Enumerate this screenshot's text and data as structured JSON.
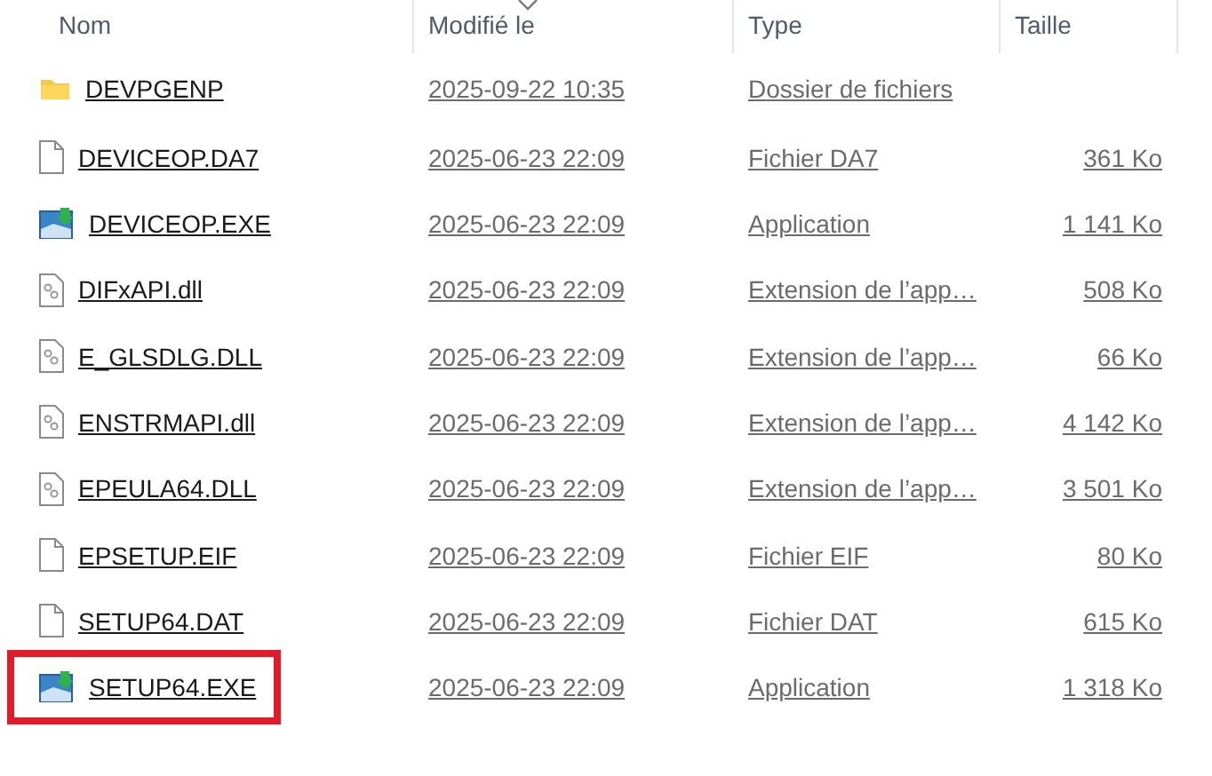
{
  "columns": [
    {
      "label": "Nom"
    },
    {
      "label": "Modifié le"
    },
    {
      "label": "Type"
    },
    {
      "label": "Taille"
    }
  ],
  "files": [
    {
      "kind": "folder",
      "name": "DEVPGENP",
      "modified": "2025-09-22 10:35",
      "type": "Dossier de fichiers",
      "highlighted": false
    },
    {
      "kind": "file",
      "name": "DEVICEOP.DA7",
      "modified": "2025-06-23 22:09",
      "type": "Fichier DA7",
      "size": "361 Ko",
      "highlighted": false
    },
    {
      "kind": "exe",
      "name": "DEVICEOP.EXE",
      "modified": "2025-06-23 22:09",
      "type": "Application",
      "size": "1 141 Ko",
      "highlighted": false
    },
    {
      "kind": "dll",
      "name": "DIFxAPI.dll",
      "modified": "2025-06-23 22:09",
      "type": "Extension de l’app…",
      "size": "508 Ko",
      "highlighted": false
    },
    {
      "kind": "dll",
      "name": "E_GLSDLG.DLL",
      "modified": "2025-06-23 22:09",
      "type": "Extension de l’app…",
      "size": "66 Ko",
      "highlighted": false
    },
    {
      "kind": "dll",
      "name": "ENSTRMAPI.dll",
      "modified": "2025-06-23 22:09",
      "type": "Extension de l’app…",
      "size": "4 142 Ko",
      "highlighted": false
    },
    {
      "kind": "dll",
      "name": "EPEULA64.DLL",
      "modified": "2025-06-23 22:09",
      "type": "Extension de l’app…",
      "size": "3 501 Ko",
      "highlighted": false
    },
    {
      "kind": "file",
      "name": "EPSETUP.EIF",
      "modified": "2025-06-23 22:09",
      "type": "Fichier EIF",
      "size": "80 Ko",
      "highlighted": false
    },
    {
      "kind": "file",
      "name": "SETUP64.DAT",
      "modified": "2025-06-23 22:09",
      "type": "Fichier DAT",
      "size": "615 Ko",
      "highlighted": false
    },
    {
      "kind": "exe",
      "name": "SETUP64.EXE",
      "modified": "2025-06-23 22:09",
      "type": "Application",
      "size": "1 318 Ko",
      "highlighted": true
    }
  ]
}
